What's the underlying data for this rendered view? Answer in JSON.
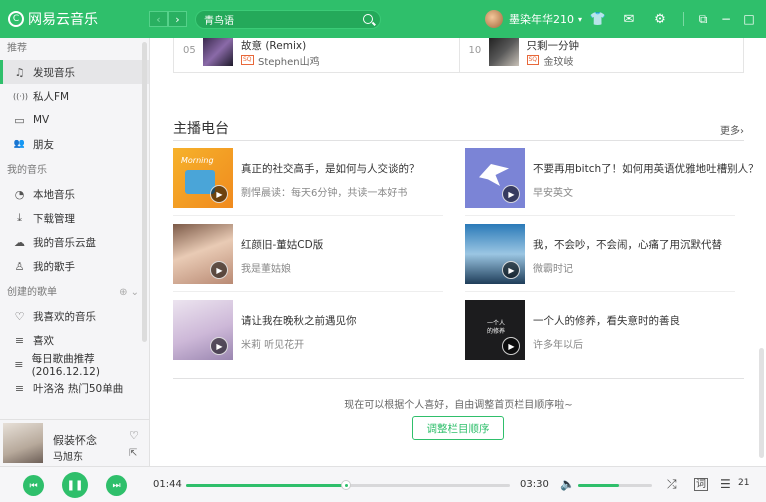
{
  "app": {
    "logo_text": "网易云音乐",
    "logo_mark": "C"
  },
  "toolbar": {
    "back": "‹",
    "forward": "›",
    "search_value": "青鸟语",
    "username": "墨染年华210",
    "caret": "▾"
  },
  "window_icons": {
    "skin": "👕",
    "mail": "✉",
    "settings": "⚙",
    "mini": "⧉",
    "minimize": "−",
    "maximize": "□",
    "close": "✕"
  },
  "sidebar": {
    "sections": [
      {
        "title": "推荐",
        "items": [
          {
            "label": "发现音乐",
            "icon": "♫",
            "active": true
          },
          {
            "label": "私人FM",
            "icon": "((·))"
          },
          {
            "label": "MV",
            "icon": "▭"
          },
          {
            "label": "朋友",
            "icon": "👥"
          }
        ]
      },
      {
        "title": "我的音乐",
        "items": [
          {
            "label": "本地音乐",
            "icon": "◔"
          },
          {
            "label": "下载管理",
            "icon": "⤓"
          },
          {
            "label": "我的音乐云盘",
            "icon": "☁"
          },
          {
            "label": "我的歌手",
            "icon": "♙"
          }
        ]
      },
      {
        "title": "创建的歌单",
        "head_icons": "⊕ ⌄",
        "items": [
          {
            "label": "我喜欢的音乐",
            "icon": "♡"
          },
          {
            "label": "喜欢",
            "icon": "≡"
          },
          {
            "label": "每日歌曲推荐(2016.12.12)",
            "icon": "≡"
          },
          {
            "label": "叶洛洛 热门50单曲",
            "icon": "≡"
          }
        ]
      }
    ]
  },
  "now_playing": {
    "title": "假装怀念",
    "artist": "马旭东",
    "heart": "♡",
    "share": "⇱"
  },
  "songs": [
    {
      "no": "05",
      "title": "故意 (Remix)",
      "quality": "SQ",
      "artist": "Stephen山鸡"
    },
    {
      "no": "10",
      "title": "只剩一分钟",
      "quality": "SQ",
      "artist": "金玟岐"
    }
  ],
  "section": {
    "title": "主播电台",
    "more": "更多›"
  },
  "radios": [
    {
      "title": "真正的社交高手，是如何与人交谈的？",
      "sub": "剽悍晨读：每天6分钟，共读一本好书",
      "cover_text": "Morning"
    },
    {
      "title": "不要再用bitch了！如何用英语优雅地吐槽别人？",
      "sub": "早安英文",
      "cover_text": ""
    },
    {
      "title": "红颜旧-董姑CD版",
      "sub": "我是董姑娘",
      "cover_text": ""
    },
    {
      "title": "我，不会吵，不会闹，心痛了用沉默代替",
      "sub": "微霸时记",
      "cover_text": ""
    },
    {
      "title": "请让我在晚秋之前遇见你",
      "sub": "米莉 听见花开",
      "cover_text": ""
    },
    {
      "title": "一个人的修养，看失意时的善良",
      "sub": "许多年以后",
      "cover_text": "一个人的修养"
    }
  ],
  "footer": {
    "hint": "现在可以根据个人喜好，自由调整首页栏目顺序啦~",
    "button": "调整栏目顺序"
  },
  "player": {
    "prev": "⏮",
    "play": "❚❚",
    "next": "⏭",
    "current_time": "01:44",
    "total_time": "03:30",
    "progress": 0.495,
    "volume": 0.55,
    "volume_icon": "🔈",
    "shuffle_icon": "⤮",
    "lyrics_icon": "词",
    "playlist_icon": "☰",
    "playlist_count": "21"
  },
  "colors": {
    "accent": "#2fbf6b"
  }
}
